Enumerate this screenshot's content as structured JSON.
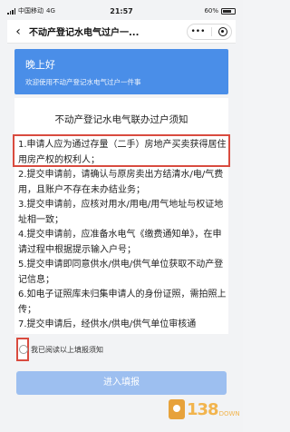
{
  "status_bar": {
    "carrier": "中国移动",
    "network": "4G",
    "time": "21:57",
    "battery": "60%"
  },
  "navbar": {
    "title": "不动产登记水电气过户一...",
    "menu_glyph": "•••"
  },
  "banner": {
    "greeting": "晚上好",
    "subtitle": "欢迎使用不动产登记水电气过户一件事"
  },
  "notice": {
    "title": "不动产登记水电气联办过户须知",
    "items": [
      "1.申请人应为通过存量（二手）房地产买卖获得居住用房产权的权利人；",
      "2.提交申请前，请确认与原房卖出方结清水/电/气费用，且账户不存在未办结业务；",
      "3.提交申请前，应核对用水/用电/用气地址与权证地址相一致；",
      "4.提交申请前，应准备水电气《缴费通知单》，在申请过程中根据提示输入户号；",
      "5.提交申请即同意供水/供电/供气单位获取不动产登记信息；",
      "6.如电子证照库未归集申请人的身份证照，需拍照上传；",
      "7.提交申请后，经供水/供电/供气单位审核通"
    ]
  },
  "agree": {
    "label": "我已阅读以上填报须知"
  },
  "submit": {
    "label": "进入填报"
  },
  "watermark": {
    "number": "138",
    "suffix": "DOWN"
  },
  "colors": {
    "banner": "#4a8ee8",
    "highlight": "#d94b3f",
    "submit": "#9dbff0"
  }
}
